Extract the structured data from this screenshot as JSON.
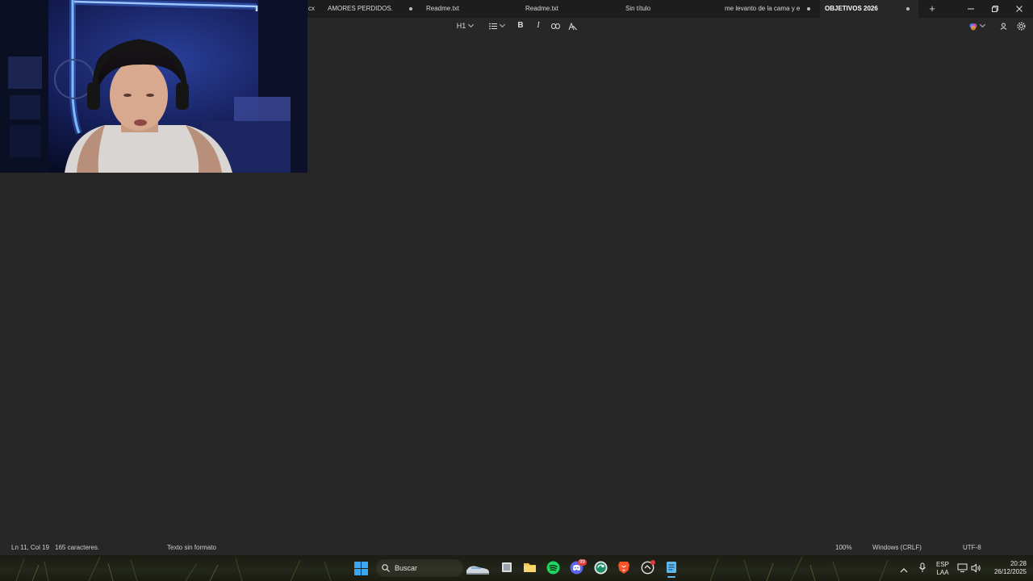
{
  "tabs": [
    {
      "title": "cx",
      "modified": false,
      "active": false
    },
    {
      "title": "AMORES PERDIDOS.",
      "modified": true,
      "active": false
    },
    {
      "title": "Readme.txt",
      "modified": false,
      "active": false
    },
    {
      "title": "Readme.txt",
      "modified": false,
      "active": false
    },
    {
      "title": "Sin título",
      "modified": false,
      "active": false
    },
    {
      "title": "me levanto de la cama y e",
      "modified": true,
      "active": false
    },
    {
      "title": "OBJETIVOS 2026",
      "modified": true,
      "active": true
    }
  ],
  "toolbar": {
    "heading_label": "H1",
    "bold_label": "B",
    "italic_label": "I"
  },
  "status": {
    "position": "Ln 11, Col 19",
    "char_count": "165 caracteres.",
    "format": "Texto sin formato",
    "zoom": "100%",
    "line_ending": "Windows (CRLF)",
    "encoding": "UTF-8"
  },
  "taskbar": {
    "search_placeholder": "Buscar",
    "discord_badge": "99",
    "language_line1": "ESP",
    "language_line2": "LAA",
    "time": "20:28",
    "date": "26/12/2025"
  },
  "colors": {
    "editor_bg": "#272727",
    "tabbar_bg": "#1d1d1d",
    "spotify": "#1ed760",
    "discord": "#5865f2",
    "brave": "#fb542b",
    "windows": "#3aa7f0"
  }
}
